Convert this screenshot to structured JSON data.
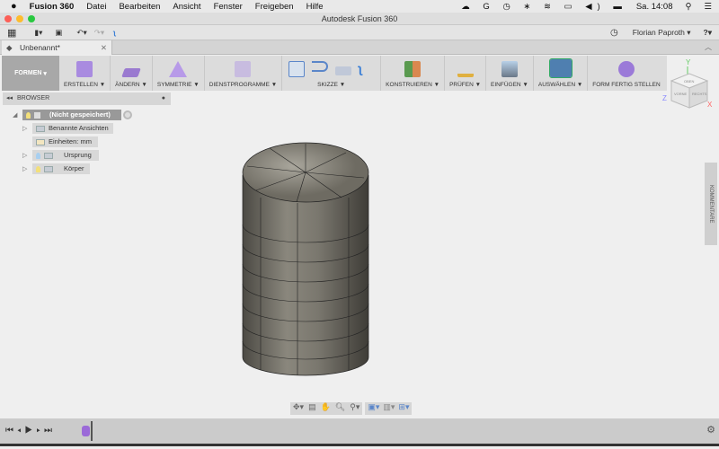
{
  "menubar": {
    "app": "Fusion 360",
    "items": [
      "Datei",
      "Bearbeiten",
      "Ansicht",
      "Fenster",
      "Freigeben",
      "Hilfe"
    ],
    "clock": "Sa. 14:08"
  },
  "window": {
    "title": "Autodesk Fusion 360"
  },
  "toolbar": {
    "user": "Florian Paproth"
  },
  "tab": {
    "label": "Unbenannt*"
  },
  "ribbon": {
    "formen": "FORMEN",
    "groups": [
      {
        "label": "ERSTELLEN ▼",
        "color": "#a98be0"
      },
      {
        "label": "ÄNDERN ▼",
        "color": "#9a7ad0"
      },
      {
        "label": "SYMMETRIE ▼",
        "color": "#b79ae8"
      },
      {
        "label": "DIENSTPROGRAMME ▼",
        "color": "#b8a8d8"
      },
      {
        "label": "SKIZZE ▼",
        "color": "#5b86c9"
      },
      {
        "label": "KONSTRUIEREN ▼",
        "color": "#d98850"
      },
      {
        "label": "PRÜFEN ▼",
        "color": "#e0b040"
      },
      {
        "label": "EINFÜGEN ▼",
        "color": "#7a98b8"
      },
      {
        "label": "AUSWÄHLEN ▼",
        "color": "#4f7fb0"
      },
      {
        "label": "FORM FERTIG STELLEN",
        "color": "#9b7ad8"
      }
    ]
  },
  "browser": {
    "title": "BROWSER",
    "items": [
      {
        "label": "(Nicht gespeichert)"
      },
      {
        "label": "Benannte Ansichten"
      },
      {
        "label": "Einheiten: mm"
      },
      {
        "label": "Ursprung"
      },
      {
        "label": "Körper"
      }
    ]
  },
  "viewcube": {
    "top": "OBEN",
    "front": "VORNE",
    "right": "RECHTS",
    "axes": [
      "Y",
      "Z",
      "X"
    ]
  },
  "comments": {
    "label": "KOMMENTARE"
  }
}
